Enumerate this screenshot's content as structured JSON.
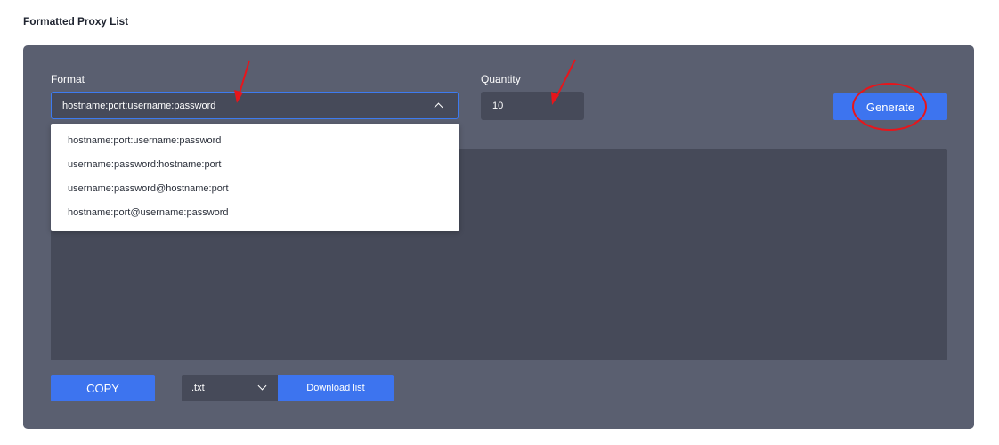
{
  "section_title": "Formatted Proxy List",
  "format": {
    "label": "Format",
    "selected": "hostname:port:username:password",
    "options": [
      "hostname:port:username:password",
      "username:password:hostname:port",
      "username:password@hostname:port",
      "hostname:port@username:password"
    ]
  },
  "quantity": {
    "label": "Quantity",
    "value": "10"
  },
  "generate_label": "Generate",
  "copy_label": "COPY",
  "file_type": {
    "selected": ".txt"
  },
  "download_label": "Download list",
  "colors": {
    "panel": "#5a5f70",
    "field": "#464a59",
    "accent": "#3d74ef",
    "annotation": "#e8151b"
  },
  "icons": {
    "format_toggle": "chevron-up-icon",
    "file_type_toggle": "chevron-down-icon"
  }
}
